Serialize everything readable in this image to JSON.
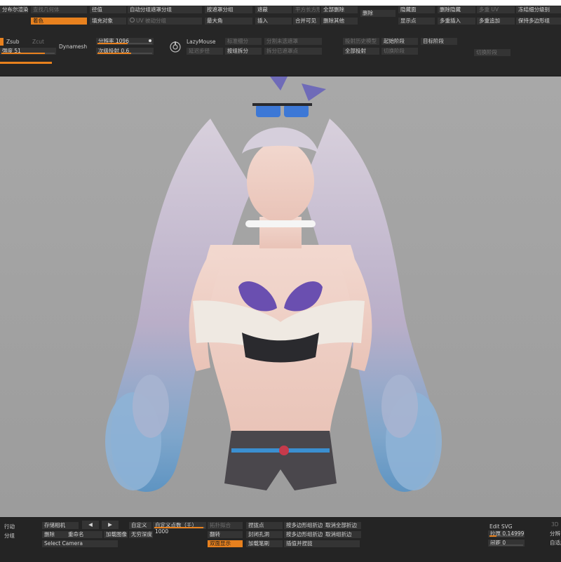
{
  "top": {
    "row0": {
      "c1": "分布尔渲染",
      "c1b": "查找几何体",
      "c2": "径值",
      "c3": "自动分组遮罩分组",
      "c4": "按遮罩分组",
      "c5": "遮蔽",
      "c6": "平方长方形",
      "c7": "全部删除",
      "c8": "删除",
      "c9": "隐藏面",
      "c10": "删除隐藏",
      "c11": "多重 UV",
      "c12": "冻结细分级别"
    },
    "row1": {
      "a": "着色",
      "b": "填充对象",
      "c": "UV 被动分组",
      "d": "最大角",
      "e": "插入",
      "f": "合并可见",
      "g": "删除其他",
      "h": "显示点",
      "i": "多重插入",
      "j": "多重追加",
      "k": "保持多边形组"
    },
    "row2": {
      "zsub": "Zsub",
      "zcut": "Zcut",
      "dynamesh": "Dynamesh",
      "resolution_label": "分辨率",
      "resolution_value": "1096",
      "lazymouse": "LazyMouse",
      "subdiv": "标准细分",
      "subdiv2": "分割未选遮罩",
      "project": "投射历史模型",
      "start_level": "起始阶段",
      "target_level": "目标阶段"
    },
    "row3": {
      "strength_label": "强度",
      "strength_value": "51",
      "proj_label": "次级投射",
      "proj_value": "0.6",
      "lazy_step": "延迟步径",
      "groups_split": "按组拆分",
      "split_masked": "拆分已遮罩点",
      "full_proj": "全部投射",
      "cut_level": "切换阶段",
      "shift_level": "切换阶段"
    },
    "brush_strength_pct": 0.68,
    "resolution_pct": 0.55,
    "proj_pct": 0.6
  },
  "bottom": {
    "b1": "行动",
    "save_camera": "存储相机",
    "prev": "◀",
    "next": "▶",
    "custom": "自定义",
    "custom_points_label": "自定义点数（千）",
    "custom_points_value": "1000",
    "retopo": "拓扑拟合",
    "pin": "捏拢点",
    "extrude_edge": "按多边形组折边",
    "cancel_all_crease": "取消全部折边",
    "delete": "删除",
    "rename": "重命名",
    "load_image": "加载图像",
    "no_depth": "无穷深度",
    "flip": "翻转",
    "seal_holes": "封闭孔洞",
    "crease_by_groups": "按多边形组折边",
    "cancel_crease": "取消组折边",
    "select_camera": "Select Camera",
    "double_sided": "双面显示",
    "load_brush": "加载笔刷",
    "interpolate_pin": "插值并捏拢",
    "edit_svg": "Edit SVG",
    "thickness_label": "拉厚",
    "thickness_value": "0.14999",
    "spacing_label": "间距",
    "spacing_value": "0",
    "right1": "3D",
    "right2": "分辨",
    "right3": "自适应",
    "b2": "分组"
  },
  "colors": {
    "accent": "#e8811e",
    "panel": "#262626",
    "viewport": "#a3a3a3"
  }
}
